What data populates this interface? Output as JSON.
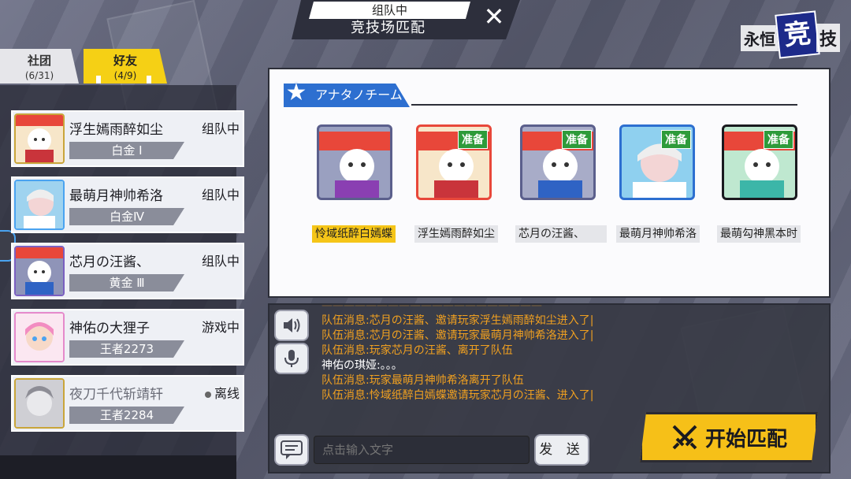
{
  "header": {
    "subtitle": "组队中",
    "title": "竞技场匹配",
    "close": "✕"
  },
  "logo": {
    "part1": "永恒",
    "part2": "竞",
    "part3": "技"
  },
  "tabs": [
    {
      "label": "社团",
      "count": "(6/31)"
    },
    {
      "label": "好友",
      "count": "(4/9)"
    }
  ],
  "friends": [
    {
      "name": "浮生嫣雨醉如尘",
      "state": "组队中",
      "rank": "白金 Ⅰ"
    },
    {
      "name": "最萌月神帅希洛",
      "state": "组队中",
      "rank": "白金Ⅳ"
    },
    {
      "name": "芯月の汪酱、",
      "state": "组队中",
      "rank": "黄金 Ⅲ"
    },
    {
      "name": "神佑の大狸子",
      "state": "游戏中",
      "rank": "王者2273"
    },
    {
      "name": "夜刀千代斩靖轩",
      "state": "离线",
      "rank": "王者2284"
    }
  ],
  "team": {
    "banner": "アナタノチーム",
    "ready_label": "准备",
    "members": [
      {
        "name": "怜域纸醉白嫣蝶",
        "ready": false
      },
      {
        "name": "浮生嫣雨醉如尘",
        "ready": true
      },
      {
        "name": "芯月の汪酱、",
        "ready": true
      },
      {
        "name": "最萌月神帅希洛",
        "ready": true
      },
      {
        "name": "最萌勾神黑本时",
        "ready": true
      }
    ]
  },
  "chat": {
    "lines": [
      {
        "text": "队伍消息:芯月の汪酱、邀请玩家浮生嫣雨醉如尘进入了|",
        "type": "system"
      },
      {
        "text": "队伍消息:芯月の汪酱、邀请玩家最萌月神帅希洛进入了|",
        "type": "system"
      },
      {
        "text": "队伍消息:玩家芯月の汪酱、离开了队伍",
        "type": "system"
      },
      {
        "text": "神佑の琪娅:。。。",
        "type": "user"
      },
      {
        "text": "队伍消息:玩家最萌月神帅希洛离开了队伍",
        "type": "system"
      },
      {
        "text": "队伍消息:怜域纸醉白嫣蝶邀请玩家芯月の汪酱、进入了|",
        "type": "system"
      }
    ],
    "input_placeholder": "点击输入文字",
    "send_label": "发 送"
  },
  "start_button": "开始匹配",
  "colors": {
    "accent_yellow": "#f5c518",
    "ready_green": "#2e9b3a",
    "system_msg": "#f0a020",
    "team_banner": "#2d6fd0"
  }
}
